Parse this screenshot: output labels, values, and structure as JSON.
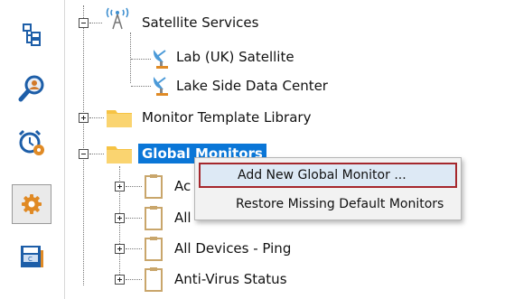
{
  "colors": {
    "selection": "#0a76d7",
    "highlight_border": "#a5272d",
    "menu_bg": "#f2f2f2"
  },
  "sidebar": {
    "items": [
      {
        "name": "tree-hierarchy-icon"
      },
      {
        "name": "search-user-icon"
      },
      {
        "name": "alarm-clock-gear-icon"
      },
      {
        "name": "settings-gear-icon",
        "active": true
      },
      {
        "name": "news-icon"
      }
    ]
  },
  "tree": {
    "satellite_services": "Satellite Services",
    "lab_uk": "Lab (UK) Satellite",
    "lake_side": "Lake Side Data Center",
    "monitor_template_library": "Monitor Template Library",
    "global_monitors": "Global Monitors",
    "child1": "Ac",
    "child2": "All",
    "child3": "All Devices - Ping",
    "child4": "Anti-Virus Status"
  },
  "context_menu": {
    "add_new": "Add New Global Monitor ...",
    "restore": "Restore Missing Default Monitors"
  }
}
